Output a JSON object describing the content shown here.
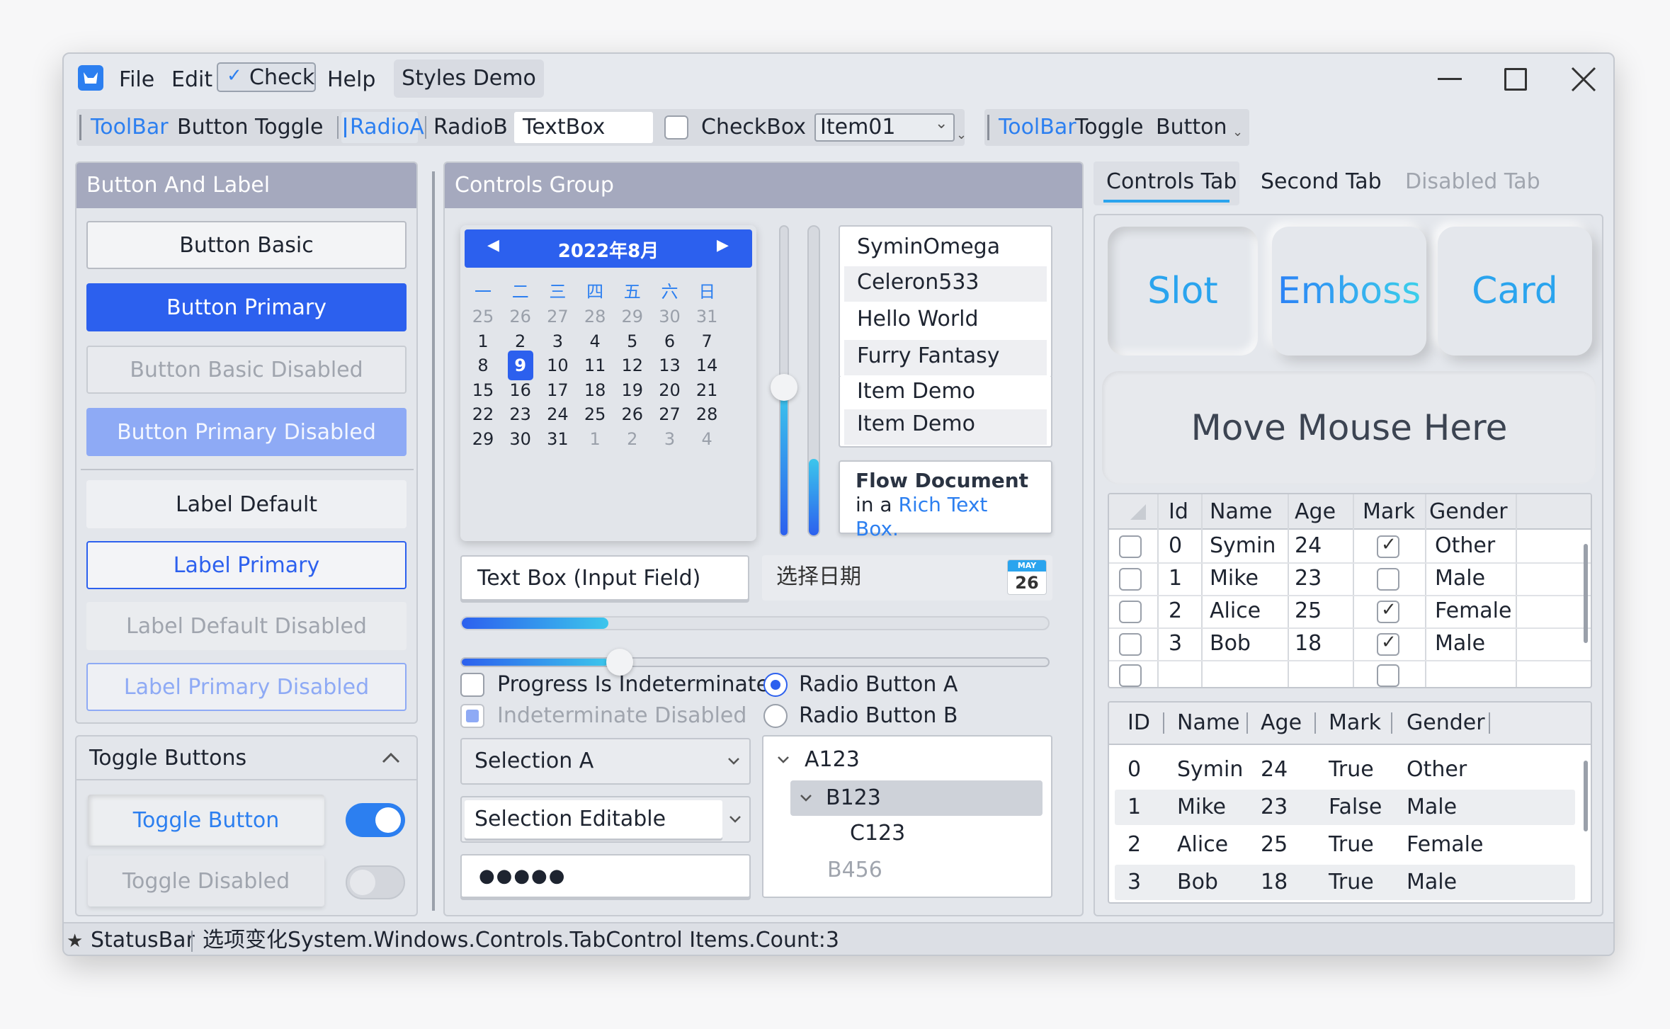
{
  "window": {
    "menu": [
      "File",
      "Edit",
      "Check",
      "Help"
    ],
    "tab": "Styles Demo"
  },
  "toolbar1": {
    "title": "ToolBar",
    "button": "Button",
    "toggle": "Toggle",
    "radioA": "RadioA",
    "radioB": "RadioB",
    "textbox": "TextBox",
    "checkbox": "CheckBox",
    "combo": "Item01"
  },
  "toolbar2": {
    "title": "ToolBar",
    "toggle": "Toggle",
    "button": "Button"
  },
  "left": {
    "header": "Button And Label",
    "buttons": [
      "Button Basic",
      "Button Primary",
      "Button Basic Disabled",
      "Button Primary Disabled"
    ],
    "labels": [
      "Label Default",
      "Label Primary",
      "Label Default Disabled",
      "Label Primary Disabled"
    ],
    "toggle_header": "Toggle Buttons",
    "toggle_button": "Toggle Button",
    "toggle_disabled": "Toggle Disabled"
  },
  "controls": {
    "header": "Controls Group",
    "calendar": {
      "title": "2022年8月",
      "weekdays": [
        "一",
        "二",
        "三",
        "四",
        "五",
        "六",
        "日"
      ],
      "rows": [
        [
          "25",
          "26",
          "27",
          "28",
          "29",
          "30",
          "31"
        ],
        [
          "1",
          "2",
          "3",
          "4",
          "5",
          "6",
          "7"
        ],
        [
          "8",
          "9",
          "10",
          "11",
          "12",
          "13",
          "14"
        ],
        [
          "15",
          "16",
          "17",
          "18",
          "19",
          "20",
          "21"
        ],
        [
          "22",
          "23",
          "24",
          "25",
          "26",
          "27",
          "28"
        ],
        [
          "29",
          "30",
          "31",
          "1",
          "2",
          "3",
          "4"
        ]
      ],
      "selected": "9"
    },
    "list": [
      "SyminOmega",
      "Celeron533",
      "Hello World",
      "Furry Fantasy",
      "Item Demo",
      "Item Demo"
    ],
    "rich": {
      "line1": "Flow Document",
      "line2a": "in a ",
      "line2b": "Rich Text Box."
    },
    "textbox": "Text Box (Input Field)",
    "date_placeholder": "选择日期",
    "cal_icon_month": "MAY",
    "cal_icon_day": "26",
    "progress": 0.25,
    "slider": 0.25,
    "check1": "Progress Is Indeterminate",
    "check2": "Indeterminate Disabled",
    "radioA": "Radio Button A",
    "radioB": "Radio Button B",
    "combo1": "Selection A",
    "combo2": "Selection Editable",
    "password": "●●●●●",
    "tree": [
      "A123",
      "B123",
      "C123",
      "B456"
    ]
  },
  "tabs": {
    "items": [
      "Controls Tab",
      "Second Tab",
      "Disabled Tab"
    ],
    "cards": [
      "Slot",
      "Emboss",
      "Card"
    ],
    "move": "Move Mouse Here"
  },
  "grid": {
    "headers": [
      "Id",
      "Name",
      "Age",
      "Mark",
      "Gender"
    ],
    "rows": [
      [
        "0",
        "Symin",
        "24",
        true,
        "Other"
      ],
      [
        "1",
        "Mike",
        "23",
        false,
        "Male"
      ],
      [
        "2",
        "Alice",
        "25",
        true,
        "Female"
      ],
      [
        "3",
        "Bob",
        "18",
        true,
        "Male"
      ]
    ]
  },
  "listview": {
    "headers": [
      "ID",
      "Name",
      "Age",
      "Mark",
      "Gender"
    ],
    "rows": [
      [
        "0",
        "Symin",
        "24",
        "True",
        "Other"
      ],
      [
        "1",
        "Mike",
        "23",
        "False",
        "Male"
      ],
      [
        "2",
        "Alice",
        "25",
        "True",
        "Female"
      ],
      [
        "3",
        "Bob",
        "18",
        "True",
        "Male"
      ]
    ]
  },
  "status": {
    "label": "StatusBar",
    "text": "选项变化System.Windows.Controls.TabControl Items.Count:3"
  },
  "colors": {
    "primary": "#2c60ee",
    "accent": "#2aa4ee",
    "header": "#a5a9be"
  }
}
